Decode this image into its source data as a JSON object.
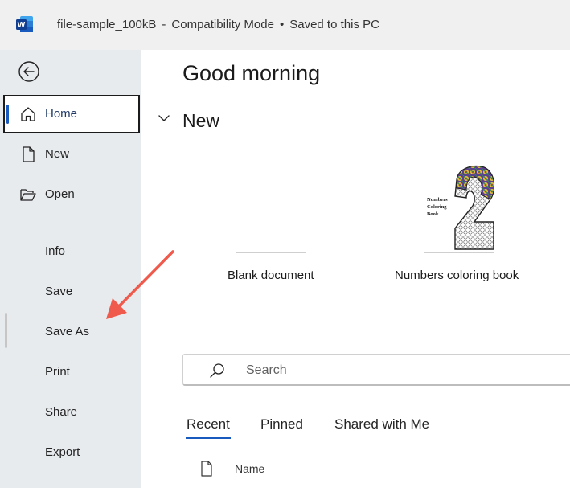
{
  "titlebar": {
    "app_icon": "word-logo",
    "filename": "file-sample_100kB",
    "mode": "Compatibility Mode",
    "save_status": "Saved to this PC"
  },
  "sidebar": {
    "back_icon": "back-arrow-icon",
    "items": [
      {
        "label": "Home",
        "icon": "home-icon",
        "active": true
      },
      {
        "label": "New",
        "icon": "new-document-icon"
      },
      {
        "label": "Open",
        "icon": "folder-open-icon"
      }
    ],
    "sub_items": [
      "Info",
      "Save",
      "Save As",
      "Print",
      "Share",
      "Export"
    ]
  },
  "main": {
    "greeting": "Good morning",
    "new_section": {
      "heading": "New",
      "templates": [
        {
          "label": "Blank document"
        },
        {
          "label": "Numbers coloring book",
          "thumb_text": "Numbers Coloring Book"
        }
      ]
    },
    "search": {
      "placeholder": "Search"
    },
    "tabs": [
      {
        "label": "Recent",
        "active": true
      },
      {
        "label": "Pinned"
      },
      {
        "label": "Shared with Me"
      }
    ],
    "file_list": {
      "column_name": "Name"
    }
  },
  "colors": {
    "accent": "#185abd",
    "annotation_arrow": "#ef5a4c",
    "sidebar_bg": "#e8ebee",
    "titlebar_bg": "#f0f0f0"
  }
}
